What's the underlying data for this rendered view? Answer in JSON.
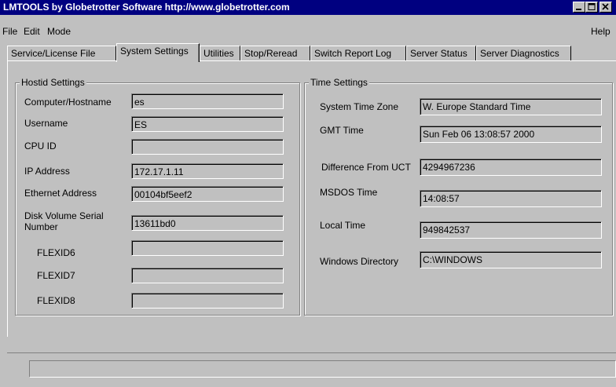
{
  "window": {
    "title": "LMTOOLS by Globetrotter Software http://www.globetrotter.com",
    "controls": [
      "minimize-icon",
      "maximize-icon",
      "close-icon"
    ]
  },
  "menu": {
    "file": "File",
    "edit": "Edit",
    "mode": "Mode",
    "help": "Help"
  },
  "tabs": [
    {
      "label": "Service/License File"
    },
    {
      "label": "System Settings",
      "active": true
    },
    {
      "label": "Utilities"
    },
    {
      "label": "Stop/Reread"
    },
    {
      "label": "Switch Report Log"
    },
    {
      "label": "Server Status"
    },
    {
      "label": "Server Diagnostics"
    }
  ],
  "hostid": {
    "title": "Hostid Settings",
    "computer_label": "Computer/Hostname",
    "computer_value": "es",
    "username_label": "Username",
    "username_value": "ES",
    "cpuid_label": "CPU ID",
    "cpuid_value": "",
    "ip_label": "IP Address",
    "ip_value": "172.17.1.11",
    "ethernet_label": "Ethernet Address",
    "ethernet_value": "00104bf5eef2",
    "disk_label_1": "Disk Volume Serial",
    "disk_label_2": "Number",
    "disk_value": "13611bd0",
    "flexid6_label": "FLEXID6",
    "flexid6_value": "",
    "flexid7_label": "FLEXID7",
    "flexid7_value": "",
    "flexid8_label": "FLEXID8",
    "flexid8_value": ""
  },
  "time": {
    "title": "Time Settings",
    "timezone_label": "System Time Zone",
    "timezone_value": "W. Europe Standard Time",
    "gmt_label": "GMT Time",
    "gmt_value": "Sun Feb 06 13:08:57 2000",
    "diff_label": "Difference From UCT",
    "diff_value": "4294967236",
    "msdos_label": "MSDOS Time",
    "msdos_value": "14:08:57",
    "local_label": "Local Time",
    "local_value": "949842537",
    "windir_label": "Windows Directory",
    "windir_value": "C:\\WINDOWS"
  },
  "status": {
    "text": ""
  }
}
